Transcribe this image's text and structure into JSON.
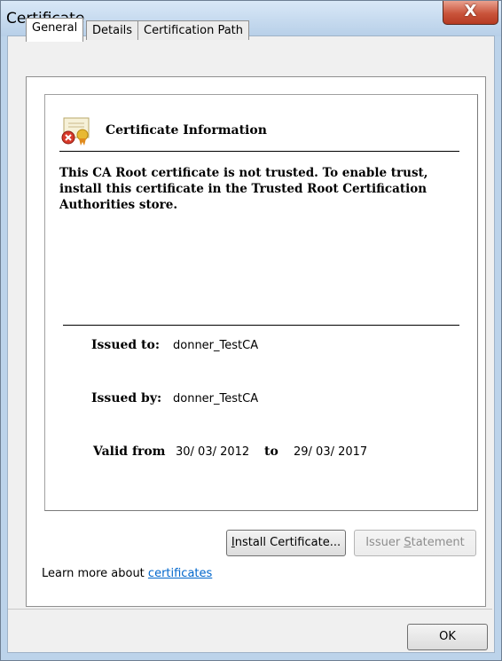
{
  "window": {
    "title": "Certificate",
    "close_label": "X"
  },
  "tabs": [
    {
      "label": "General",
      "active": true
    },
    {
      "label": "Details",
      "active": false
    },
    {
      "label": "Certification Path",
      "active": false
    }
  ],
  "info": {
    "icon": "certificate-error-icon",
    "title": "Certificate Information",
    "warning": "This CA Root certificate is not trusted. To enable trust, install this certificate in the Trusted Root Certification Authorities store."
  },
  "fields": {
    "issued_to_label": "Issued to:",
    "issued_to_value": "donner_TestCA",
    "issued_by_label": "Issued by:",
    "issued_by_value": "donner_TestCA",
    "valid_from_label": "Valid from",
    "valid_from_value": "30/ 03/ 2012",
    "to_label": "to",
    "valid_to_value": "29/ 03/ 2017"
  },
  "buttons": {
    "install_prefix": "I",
    "install_rest": "nstall Certificate...",
    "issuer_prefix": "Issuer ",
    "issuer_ul": "S",
    "issuer_rest": "tatement",
    "ok": "OK"
  },
  "learn_more": {
    "text": "Learn more about ",
    "link": "certificates"
  },
  "colors": {
    "link": "#0066cc",
    "close_button": "#c9543b"
  }
}
